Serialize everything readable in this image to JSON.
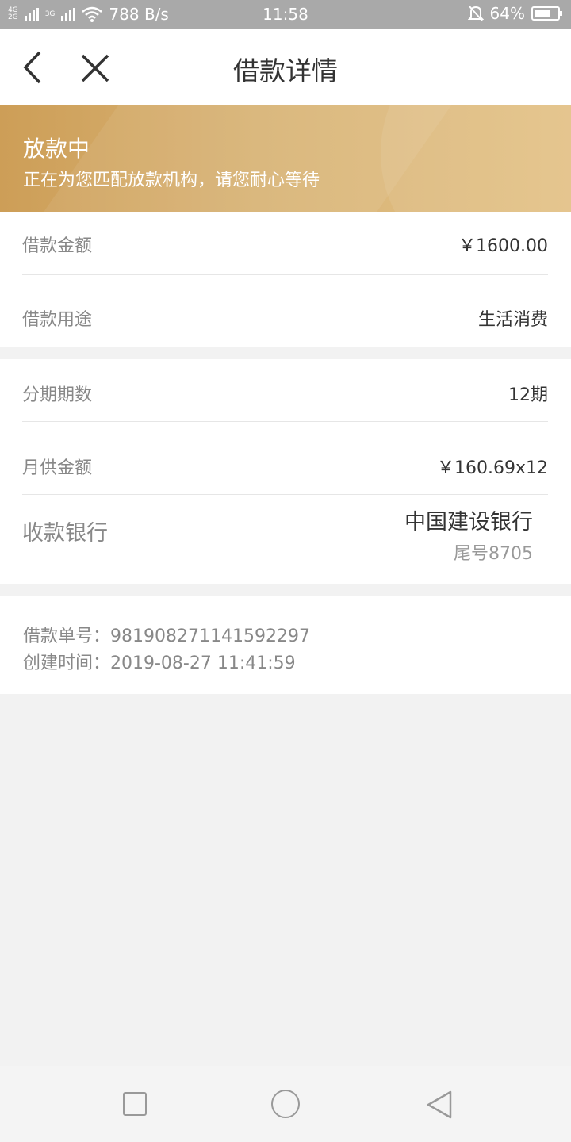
{
  "status_bar": {
    "net_top": "4G",
    "net_bottom": "2G",
    "net2": "3G",
    "speed": "788 B/s",
    "time": "11:58",
    "battery": "64%",
    "icons": [
      "signal-icon",
      "wifi-icon",
      "bell-muted-icon",
      "battery-icon"
    ]
  },
  "nav": {
    "title": "借款详情",
    "back_icon": "chevron-left-icon",
    "close_icon": "close-icon"
  },
  "banner": {
    "status": "放款中",
    "description": "正在为您匹配放款机构，请您耐心等待"
  },
  "loan": {
    "amount_label": "借款金额",
    "amount_value": "￥1600.00",
    "purpose_label": "借款用途",
    "purpose_value": "生活消费"
  },
  "installment": {
    "periods_label": "分期期数",
    "periods_value": "12期",
    "monthly_label": "月供金额",
    "monthly_value": "￥160.69x12",
    "bank_label": "收款银行",
    "bank_name": "中国建设银行",
    "bank_tail": "尾号8705"
  },
  "order": {
    "number_line": "借款单号：981908271141592297",
    "created_line": "创建时间：2019-08-27 11:41:59"
  },
  "system_nav": {
    "recent_icon": "square-icon",
    "home_icon": "circle-icon",
    "back_icon": "triangle-back-icon"
  },
  "colors": {
    "banner_start": "#cd9e57",
    "banner_end": "#e3c186",
    "background": "#f2f2f2"
  }
}
